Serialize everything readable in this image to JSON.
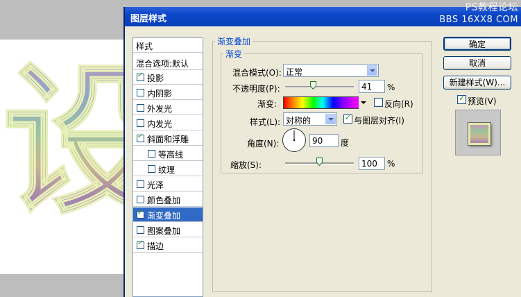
{
  "canvas": {
    "big_char": "设"
  },
  "dialog": {
    "title": "图层样式",
    "watermark_line1": "PS教程论坛",
    "watermark_line2": "BBS 16XX8 COM"
  },
  "style_list": {
    "header": "样式",
    "blend_options": "混合选项:默认",
    "items": [
      {
        "label": "投影",
        "checked": true
      },
      {
        "label": "内阴影",
        "checked": false
      },
      {
        "label": "外发光",
        "checked": false
      },
      {
        "label": "内发光",
        "checked": false
      },
      {
        "label": "斜面和浮雕",
        "checked": true
      },
      {
        "label": "等高线",
        "checked": false
      },
      {
        "label": "纹理",
        "checked": false
      },
      {
        "label": "光泽",
        "checked": false
      },
      {
        "label": "颜色叠加",
        "checked": false
      },
      {
        "label": "渐变叠加",
        "checked": true
      },
      {
        "label": "图案叠加",
        "checked": false
      },
      {
        "label": "描边",
        "checked": true
      }
    ]
  },
  "gradient_overlay": {
    "section_title": "渐变叠加",
    "subsection_title": "渐变",
    "blend_mode_label": "混合模式(O):",
    "blend_mode_value": "正常",
    "opacity_label": "不透明度(P):",
    "opacity_value": "41",
    "opacity_unit": "%",
    "opacity_fraction": 0.41,
    "gradient_label": "渐变:",
    "reverse_label": "反向(R)",
    "reverse_checked": false,
    "style_label": "样式(L):",
    "style_value": "对称的",
    "align_label": "与图层对齐(I)",
    "align_checked": true,
    "angle_label": "角度(N):",
    "angle_value": "90",
    "angle_unit": "度",
    "scale_label": "缩放(S):",
    "scale_value": "100",
    "scale_unit": "%",
    "scale_fraction": 0.5
  },
  "buttons": {
    "ok": "确定",
    "cancel": "取消",
    "new_style": "新建样式(W)...",
    "preview_label": "预览(V)",
    "preview_checked": true
  }
}
